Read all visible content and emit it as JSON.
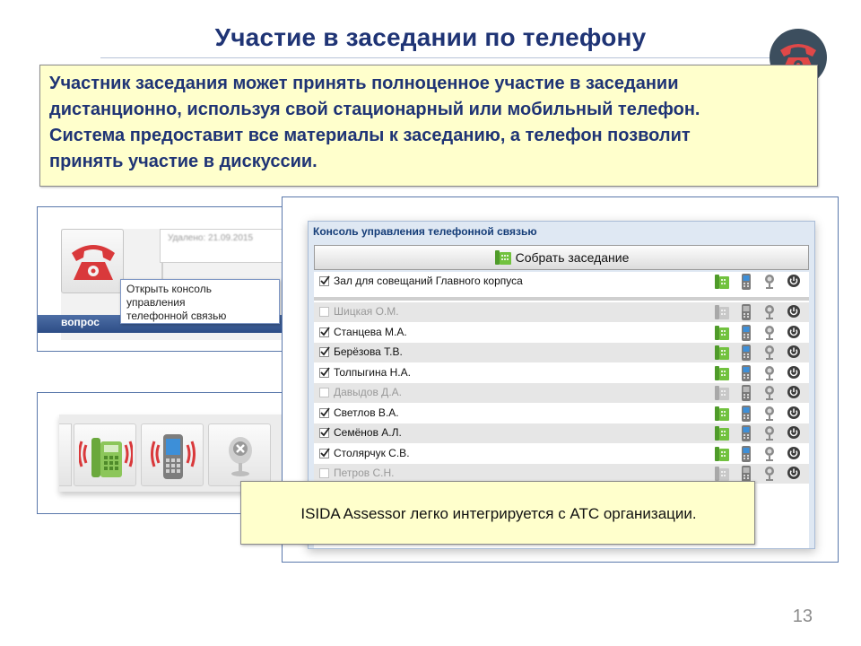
{
  "slide": {
    "title": "Участие в заседании по телефону",
    "intro": "Участник заседания может принять полноценное участие в заседании\nдистанционно, используя свой стационарный или мобильный телефон.\nСистема предоставит все материалы к заседанию, а телефон позволит\nпринять участие в дискуссии.",
    "page_number": "13",
    "note": "ISIDA Assessor легко интегрируется с АТС организации."
  },
  "colors": {
    "title": "#1f3475",
    "note_bg": "#ffffcc",
    "badge_bg": "#3c4e5e",
    "phone_red": "#d9393b",
    "active_green": "#57b32c",
    "blue_bar": "#2d4d86"
  },
  "panel1": {
    "blurred_field_text": "Удалено: 21.09.2015",
    "tooltip": "Открыть консоль\nуправления\nтелефонной связью",
    "bar_label": "вопрос",
    "button_icon": "red-phone-icon"
  },
  "panel2": {
    "buttons": [
      {
        "icon": "desk-phone-ringing-icon"
      },
      {
        "icon": "mobile-phone-ringing-icon"
      },
      {
        "icon": "microphone-muted-icon"
      }
    ]
  },
  "console": {
    "title": "Консоль управления телефонной связью",
    "collect_button": "Собрать заседание",
    "hall": {
      "name": "Зал для совещаний Главного корпуса",
      "checked": true,
      "active": true
    },
    "participants": [
      {
        "name": "Шицкая О.М.",
        "checked": false,
        "active": false
      },
      {
        "name": "Станцева М.А.",
        "checked": true,
        "active": true
      },
      {
        "name": "Берёзова Т.В.",
        "checked": true,
        "active": true
      },
      {
        "name": "Толпыгина Н.А.",
        "checked": true,
        "active": true
      },
      {
        "name": "Давыдов Д.А.",
        "checked": false,
        "active": false
      },
      {
        "name": "Светлов В.А.",
        "checked": true,
        "active": true
      },
      {
        "name": "Семёнов А.Л.",
        "checked": true,
        "active": true
      },
      {
        "name": "Столярчук С.В.",
        "checked": true,
        "active": true
      },
      {
        "name": "Петров С.Н.",
        "checked": false,
        "active": false
      }
    ],
    "row_icons": [
      "desk-phone-icon",
      "mobile-phone-icon",
      "microphone-icon",
      "power-icon"
    ]
  }
}
